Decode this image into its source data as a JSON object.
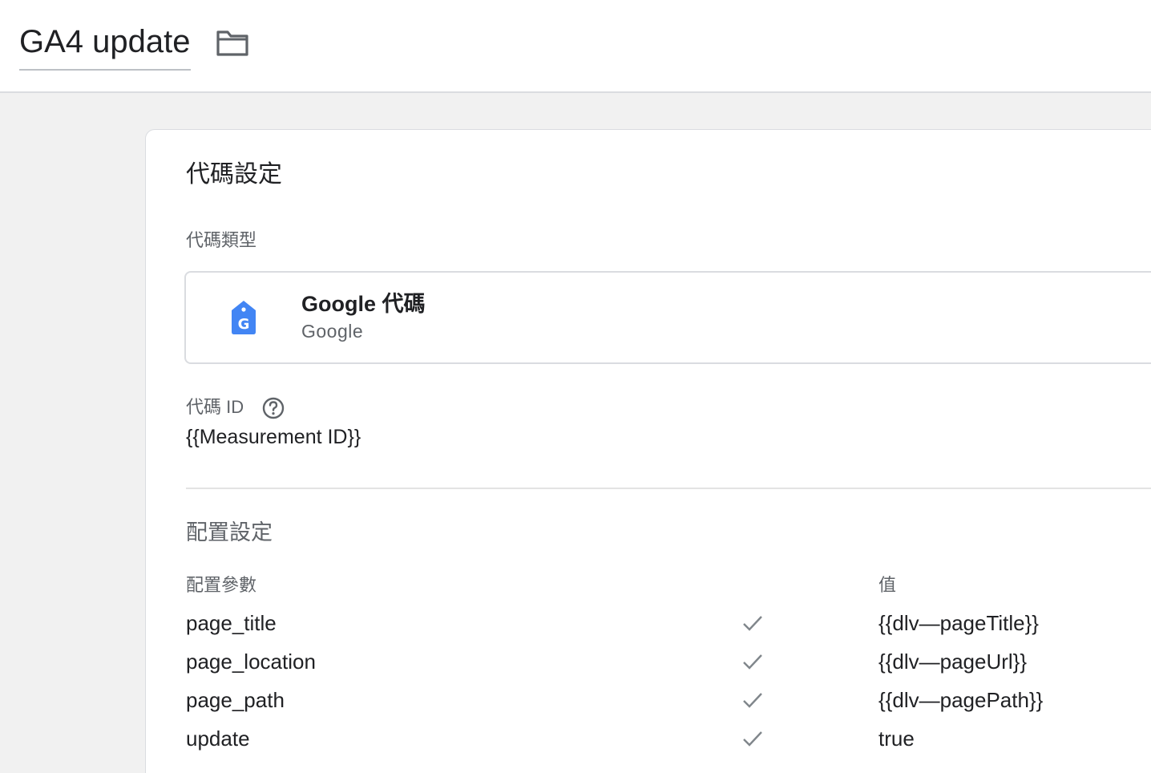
{
  "header": {
    "title": "GA4 update",
    "folder_icon": "folder-icon"
  },
  "tag_config": {
    "section_title": "代碼設定",
    "tag_type_label": "代碼類型",
    "tag_type": {
      "name": "Google 代碼",
      "vendor": "Google",
      "icon": "google-tag-icon",
      "icon_color": "#4285f4"
    },
    "tag_id_label": "代碼 ID",
    "tag_id_help_icon": "help-circle-icon",
    "tag_id_value": "{{Measurement ID}}"
  },
  "configuration": {
    "title": "配置設定",
    "param_header": "配置參數",
    "value_header": "值",
    "rows": [
      {
        "name": "page_title",
        "value": "{{dlv—pageTitle}}",
        "check_icon": "check-icon"
      },
      {
        "name": "page_location",
        "value": "{{dlv—pageUrl}}",
        "check_icon": "check-icon"
      },
      {
        "name": "page_path",
        "value": "{{dlv—pagePath}}",
        "check_icon": "check-icon"
      },
      {
        "name": "update",
        "value": "true",
        "check_icon": "check-icon"
      }
    ]
  }
}
